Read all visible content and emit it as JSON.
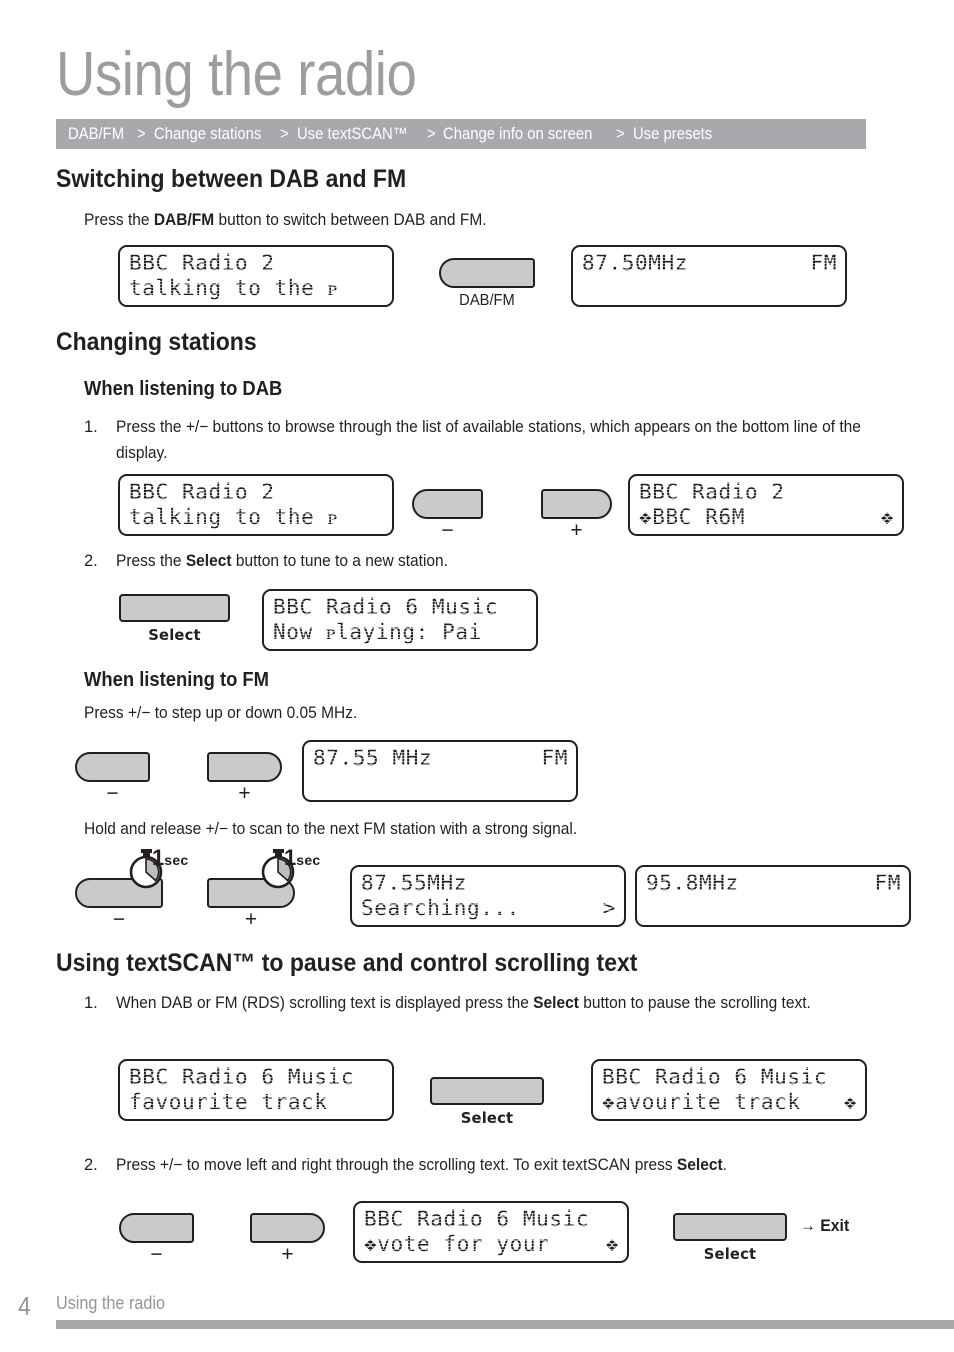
{
  "page": {
    "title": "Using the radio",
    "number": "4",
    "footer_label": "Using the radio"
  },
  "breadcrumb": {
    "separator": ">",
    "items": [
      "DAB/FM",
      "Change stations",
      "Use textSCAN™",
      "Change info on screen",
      "Use presets"
    ]
  },
  "colors": {
    "title_gray": "#9b9d9f",
    "bar_gray": "#a7a9ac",
    "button_gray": "#c9cacb",
    "ink": "#231f20"
  },
  "sections": {
    "switching": {
      "heading": "Switching between DAB and FM",
      "intro_prefix": "Press the ",
      "intro_bold": "DAB/FM",
      "intro_suffix": " button to switch between DAB and FM.",
      "display_dab": {
        "line1": "BBC Radio 2",
        "line2": "talking to the ᴘ"
      },
      "button": {
        "label": "DAB/FM",
        "name": "dab-fm-button"
      },
      "display_fm": {
        "line1_left": "87.50MHz",
        "line1_right": "FM",
        "line2": ""
      }
    },
    "changing": {
      "heading": "Changing stations",
      "dab": {
        "subheading": "When listening to DAB",
        "step1_number": "1.",
        "step1_text": "Press the  +/−  buttons to browse through the list of available stations, which appears on the bottom line of the display.",
        "display_before": {
          "line1": "BBC Radio 2",
          "line2": "talking to the ᴘ"
        },
        "minus_label": "−",
        "plus_label": "+",
        "display_after": {
          "line1": "BBC Radio 2",
          "line2_left": "❖BBC R6M",
          "line2_right": "❖"
        },
        "step2_number": "2.",
        "step2_prefix": "Press the ",
        "step2_bold": "Select",
        "step2_suffix": " button to tune to a new station.",
        "select_label": "Select",
        "display_tuned": {
          "line1": "BBC Radio 6 Music",
          "line2": "Now ᴘlaying: Pai"
        }
      },
      "fm": {
        "subheading": "When listening to FM",
        "step_text": "Press  +/−  to step up or down 0.05 MHz.",
        "minus_label": "−",
        "plus_label": "+",
        "display_step": {
          "line1_left": "87.55 MHz",
          "line1_right": "FM",
          "line2": ""
        },
        "hold_text": "Hold and release  +/−  to scan to the next FM station with a strong signal.",
        "hold_time_number": "1",
        "hold_time_unit": "sec",
        "display_searching": {
          "line1_left": "87.55MHz",
          "line1_right": "",
          "line2_left": "Searching...",
          "line2_right": ">"
        },
        "display_found": {
          "line1_left": "95.8MHz",
          "line1_right": "FM",
          "line2": ""
        }
      }
    },
    "textscan": {
      "heading": "Using textSCAN™ to pause and control scrolling text",
      "step1_number": "1.",
      "step1_a": "When DAB or FM (RDS) scrolling text is displayed press the ",
      "step1_bold": "Select",
      "step1_b": " button to pause the scrolling text.",
      "display_scrolling": {
        "line1": "BBC Radio 6 Music",
        "line2": "favourite track"
      },
      "select_label": "Select",
      "display_paused": {
        "line1": "BBC Radio 6 Music",
        "line2_left": "❖avourite track",
        "line2_right": "❖"
      },
      "step2_number": "2.",
      "step2_a": "Press  +/−  to move left and right through the scrolling text. To exit textSCAN press ",
      "step2_bold": "Select",
      "step2_b": ".",
      "minus_label": "−",
      "plus_label": "+",
      "display_moved": {
        "line1": "BBC Radio 6 Music",
        "line2_left": "❖vote for your",
        "line2_right": "❖"
      },
      "select_label_2": "Select",
      "exit_arrow": "→",
      "exit_label": "Exit"
    }
  }
}
